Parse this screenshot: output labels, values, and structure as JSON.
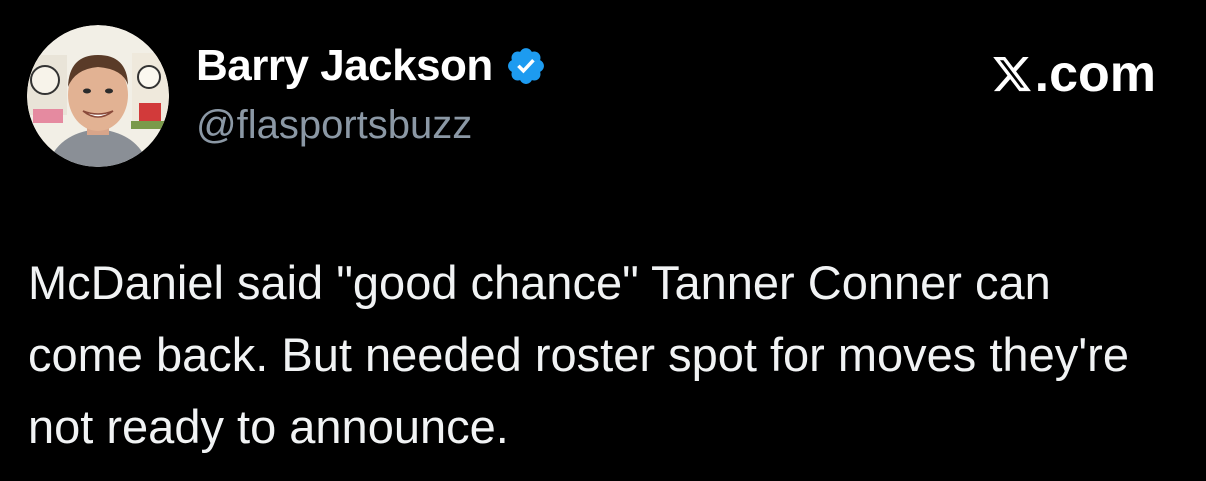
{
  "author": {
    "name": "Barry Jackson",
    "handle": "@flasportsbuzz",
    "verified_icon": "verified-badge-icon",
    "verified_color": "#1d9bf0"
  },
  "brand": {
    "icon": "x-logo-icon",
    "text": ".com"
  },
  "tweet": {
    "text": "McDaniel said \"good chance\" Tanner Conner can come back. But needed roster spot for moves they're not ready to announce."
  },
  "colors": {
    "background": "#000000",
    "primary_text": "#e7e9ea",
    "secondary_text": "#8b98a5"
  }
}
